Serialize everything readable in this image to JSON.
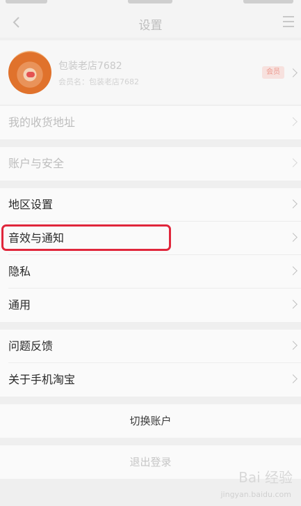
{
  "nav": {
    "title": "设置"
  },
  "profile": {
    "name": "包装老店7682",
    "subtitle": "会员名：包装老店7682",
    "badge": "会员"
  },
  "rows": [
    {
      "label": "我的收货地址"
    },
    {
      "label": "账户与安全"
    },
    {
      "label": "地区设置"
    },
    {
      "label": "音效与通知"
    },
    {
      "label": "隐私"
    },
    {
      "label": "通用"
    },
    {
      "label": "问题反馈"
    },
    {
      "label": "关于手机淘宝"
    }
  ],
  "actions": {
    "switch_account": "切换账户",
    "logout": "退出登录"
  },
  "watermark": {
    "brand": "Bai 经验",
    "url": "jingyan.baidu.com"
  },
  "colors": {
    "highlight": "#e0263b"
  }
}
